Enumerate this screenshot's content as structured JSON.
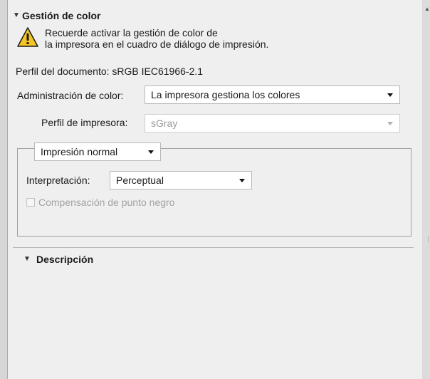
{
  "color_mgmt": {
    "title": "Gestión de color",
    "warning_line1": "Recuerde activar la gestión de color de",
    "warning_line2": "la impresora en el cuadro de diálogo de impresión.",
    "document_profile": "Perfil del documento: sRGB IEC61966-2.1",
    "admin_label": "Administración de color:",
    "admin_value": "La impresora gestiona los colores",
    "printer_profile_label": "Perfil de impresora:",
    "printer_profile_value": "sGray",
    "print_mode_value": "Impresión normal",
    "interpretation_label": "Interpretación:",
    "interpretation_value": "Perceptual",
    "black_point_label": "Compensación de punto negro",
    "black_point_checked": false
  },
  "description": {
    "title": "Descripción"
  },
  "colors": {
    "panel_bg": "#efefef",
    "warning_yellow": "#f3c623"
  }
}
